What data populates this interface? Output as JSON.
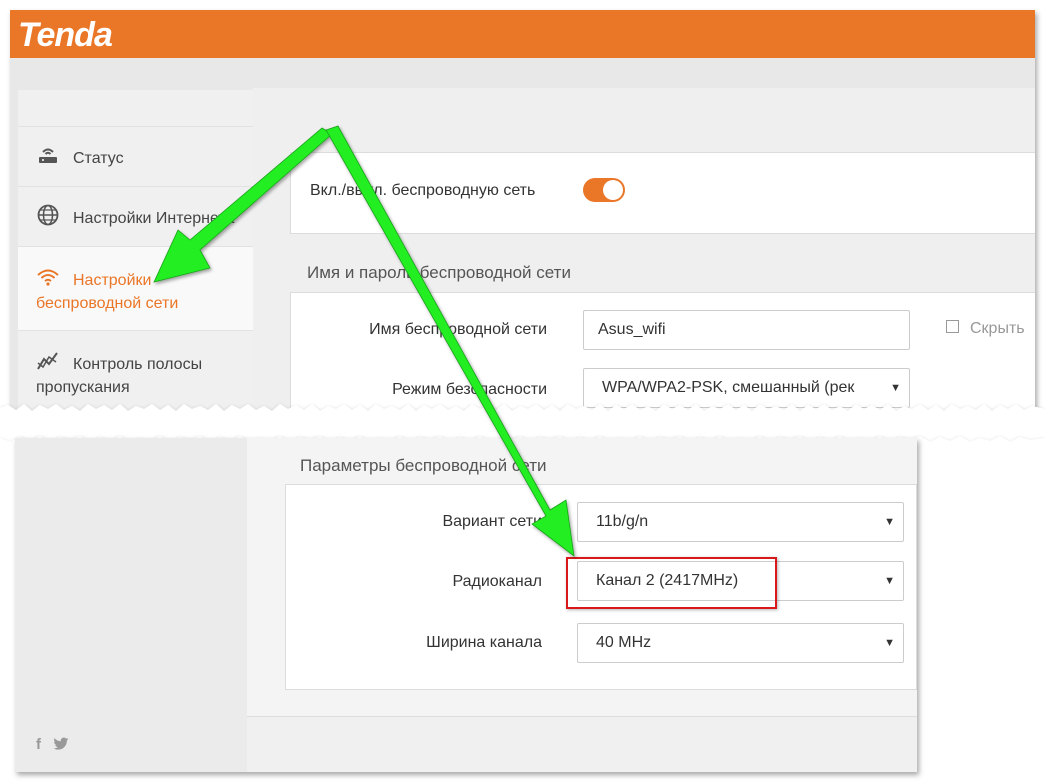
{
  "brand": {
    "logo_text": "Tenda",
    "accent_color": "#ea7627"
  },
  "sidebar": {
    "items": [
      {
        "label": "Статус",
        "icon": "router-icon",
        "active": false
      },
      {
        "label": "Настройки Интернета",
        "icon": "globe-icon",
        "active": false
      },
      {
        "label_line1": "Настройки",
        "label_line2": "беспроводной сети",
        "icon": "wifi-icon",
        "active": true
      },
      {
        "label_line1": "Контроль полосы",
        "label_line2": "пропускания",
        "icon": "bandwidth-chart-icon",
        "active": false
      }
    ]
  },
  "wireless_toggle": {
    "label": "Вкл./выкл. беспроводную сеть",
    "on": true
  },
  "ssid_section": {
    "title": "Имя и пароль беспроводной сети",
    "ssid_label": "Имя беспроводной сети",
    "ssid_value": "Asus_wifi",
    "hide_label": "Скрыть",
    "security_label": "Режим безопасности",
    "security_value": "WPA/WPA2-PSK, смешанный (рек"
  },
  "params_section": {
    "title": "Параметры беспроводной сети",
    "mode_label": "Вариант сети",
    "mode_value": "11b/g/n",
    "channel_label": "Радиоканал",
    "channel_value": "Канал 2 (2417MHz)",
    "width_label": "Ширина канала",
    "width_value": "40 MHz"
  },
  "footer": {
    "facebook": "f",
    "twitter": "t"
  },
  "annotation": {
    "arrow_color": "#22ee22",
    "highlight_color": "#d9181a"
  }
}
